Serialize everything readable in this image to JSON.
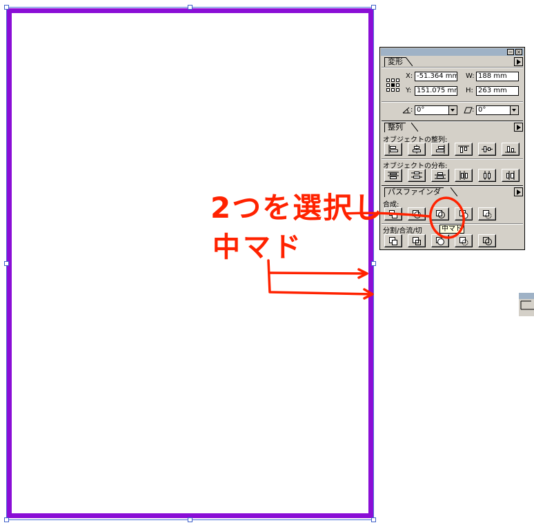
{
  "transform_panel": {
    "tab_label": "変形",
    "x_label": "X:",
    "x_value": "-51.364 mm",
    "y_label": "Y:",
    "y_value": "151.075 mm",
    "w_label": "W:",
    "w_value": "188 mm",
    "h_label": "H:",
    "h_value": "263 mm",
    "rotate_value": "0°",
    "shear_value": "0°"
  },
  "align_panel": {
    "tab_label": "整列",
    "align_objects_label": "オブジェクトの整列:",
    "distribute_objects_label": "オブジェクトの分布:"
  },
  "pathfinder_panel": {
    "tab_label": "パスファインダ",
    "combine_label": "合成:",
    "divide_label": "分割/合流/切",
    "tooltip": "中マド"
  },
  "annotations": {
    "instruction_line1": "2つを選択し",
    "instruction_line2": "中マド",
    "ink_color": "#ff2200"
  },
  "colors": {
    "artboard_stroke": "#8a0ed6",
    "selection": "#4a6fd8",
    "panel_bg": "#d4d0c8",
    "titlebar": "#9fb2c6"
  }
}
